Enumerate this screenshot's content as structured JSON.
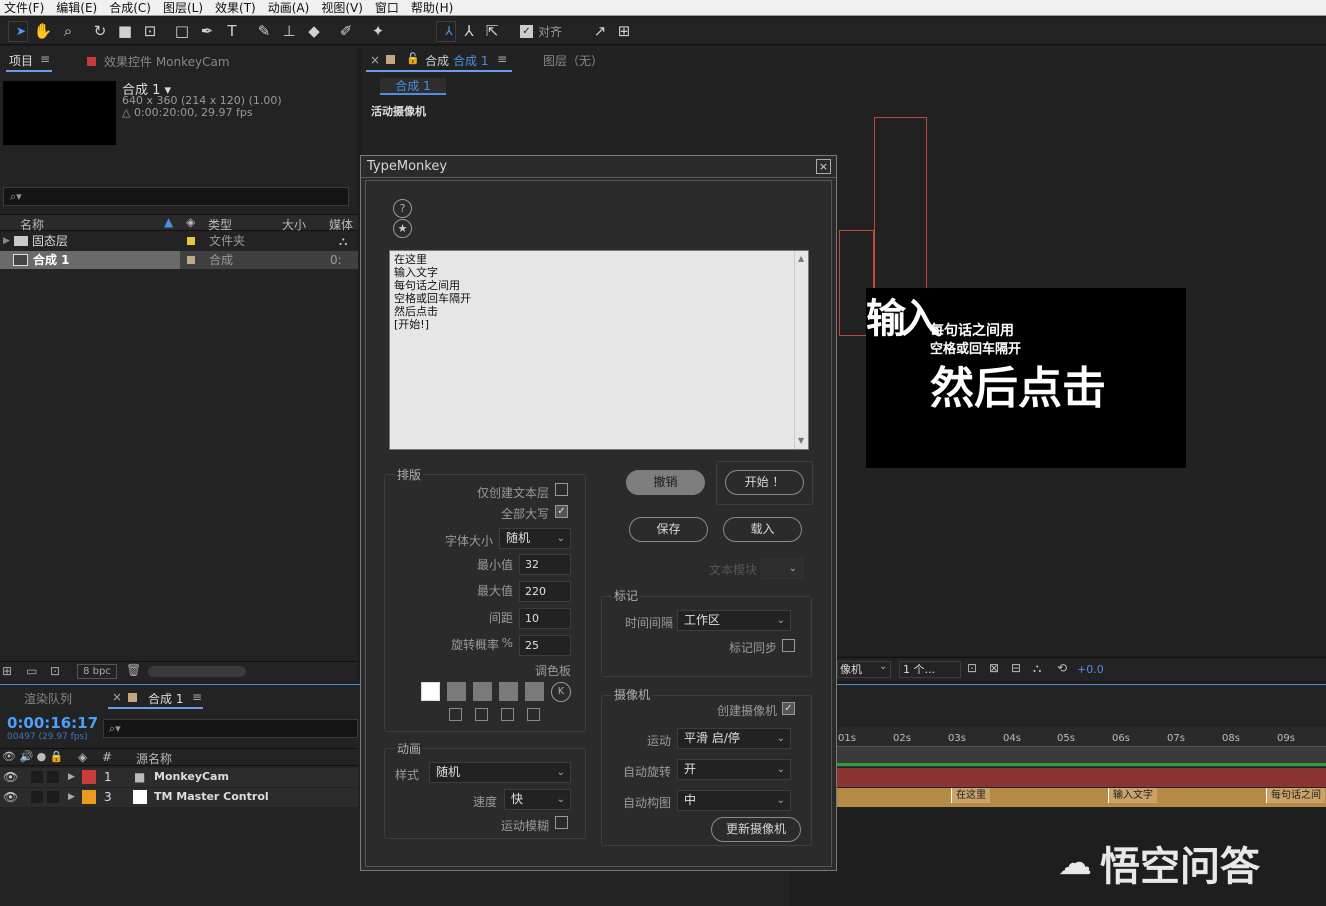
{
  "menu": [
    "文件(F)",
    "编辑(E)",
    "合成(C)",
    "图层(L)",
    "效果(T)",
    "动画(A)",
    "视图(V)",
    "窗口",
    "帮助(H)"
  ],
  "toolbar": {
    "align_label": "对齐"
  },
  "project": {
    "tab": "项目",
    "effects_tab": "效果控件 MonkeyCam",
    "comp_name": "合成 1 ▾",
    "comp_size": "640 x 360  (214 x 120) (1.00)",
    "comp_dur": "△ 0:00:20:00, 29.97 fps",
    "search_icon": "⌕▾",
    "columns": [
      "名称",
      "类型",
      "大小",
      "媒体"
    ],
    "items": [
      {
        "name": "固态层",
        "type": "文件夹",
        "color": "#e8c63a"
      },
      {
        "name": "合成 1",
        "type": "合成",
        "color": "#bfa882",
        "extra": "0:"
      }
    ],
    "bpc": "8 bpc"
  },
  "comp": {
    "tab_label": "合成",
    "comp_link": "合成 1",
    "layers_tab": "图层（无）",
    "subtab": "合成 1",
    "camera_label": "活动摄像机",
    "preview_lines": [
      "每句话之间用",
      "空格或回车隔开",
      "然后点击"
    ],
    "preview_big": "然后点击",
    "preview_partial": "输入"
  },
  "viewer_bar": {
    "camera": "像机",
    "views": "1 个...",
    "exposure": "+0.0"
  },
  "timeline": {
    "render_tab": "渲染队列",
    "comp_tab": "合成 1",
    "timecode": "0:00:16:17",
    "frames": "00497 (29.97 fps)",
    "col_num": "#",
    "col_name": "源名称",
    "layers": [
      {
        "num": "1",
        "name": "MonkeyCam",
        "color": "#c83c3c"
      },
      {
        "num": "3",
        "name": "TM Master Control",
        "color": "#e89b1e"
      }
    ],
    "ticks": [
      "01s",
      "02s",
      "03s",
      "04s",
      "05s",
      "06s",
      "07s",
      "08s",
      "09s"
    ],
    "markers": [
      "在这里",
      "输入文字",
      "每句话之间"
    ]
  },
  "dialog": {
    "title": "TypeMonkey",
    "close": "×",
    "text_lines": [
      "在这里",
      "输入文字",
      "每句话之间用",
      "空格或回车隔开",
      "然后点击",
      "[开始!]"
    ],
    "layout": {
      "title": "排版",
      "text_layer_only": "仅创建文本层",
      "all_caps": "全部大写",
      "font_size_label": "字体大小",
      "font_size": "随机",
      "min_label": "最小值",
      "min": "32",
      "max_label": "最大值",
      "max": "220",
      "spacing_label": "间距",
      "spacing": "10",
      "rotation_label": "旋转概率",
      "rotation_unit": "%",
      "rotation": "25",
      "palette_label": "调色板",
      "k_icon": "K"
    },
    "animation": {
      "title": "动画",
      "style_label": "样式",
      "style": "随机",
      "speed_label": "速度",
      "speed": "快",
      "motion_blur": "运动模糊"
    },
    "buttons": {
      "undo": "撤销",
      "start": "开始 ！",
      "save": "保存",
      "load": "载入",
      "text_block": "文本模块"
    },
    "markers": {
      "title": "标记",
      "interval_label": "时间间隔",
      "interval": "工作区",
      "sync": "标记同步"
    },
    "camera": {
      "title": "摄像机",
      "create": "创建摄像机",
      "motion_label": "运动",
      "motion": "平滑 启/停",
      "autorotate_label": "自动旋转",
      "autorotate": "开",
      "autoframe_label": "自动构图",
      "autoframe": "中",
      "update": "更新摄像机"
    }
  },
  "watermark": "悟空问答"
}
